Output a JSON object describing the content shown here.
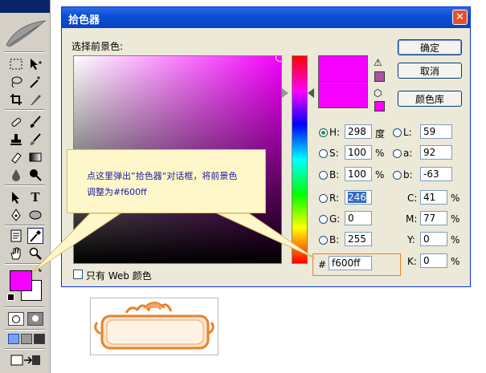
{
  "dialog": {
    "title": "拾色器",
    "close_glyph": "✕",
    "select_label": "选择前景色:",
    "ok_label": "确定",
    "cancel_label": "取消",
    "library_label": "颜色库",
    "web_only_label": "只有 Web 颜色",
    "warning_glyph": "⚠",
    "cube_glyph": "⬡"
  },
  "hsb": {
    "h_label": "H:",
    "h_value": "298",
    "h_unit": "度",
    "s_label": "S:",
    "s_value": "100",
    "s_unit": "%",
    "b_label": "B:",
    "b_value": "100",
    "b_unit": "%"
  },
  "rgb": {
    "r_label": "R:",
    "r_value": "246",
    "g_label": "G:",
    "g_value": "0",
    "b_label": "B:",
    "b_value": "255"
  },
  "lab": {
    "l_label": "L:",
    "l_value": "59",
    "a_label": "a:",
    "a_value": "92",
    "b_label": "b:",
    "b_value": "-63"
  },
  "cmyk": {
    "c_label": "C:",
    "c_value": "41",
    "c_unit": "%",
    "m_label": "M:",
    "m_value": "77",
    "m_unit": "%",
    "y_label": "Y:",
    "y_value": "0",
    "y_unit": "%",
    "k_label": "K:",
    "k_value": "0",
    "k_unit": "%"
  },
  "hex": {
    "label": "#",
    "value": "f600ff"
  },
  "callout": {
    "line1": "点这里弹出”拾色器“对话框，将前景色",
    "line2": "调整为#f600ff"
  },
  "colors": {
    "selected": "#f600ff",
    "previous": "#f600ff",
    "web_safe": "#ff00ff",
    "gamut_swatch": "#b050a8",
    "accent_orange": "#e8822a"
  },
  "toolbar": {
    "icons": [
      "marquee-icon",
      "move-icon",
      "lasso-icon",
      "magic-wand-icon",
      "crop-icon",
      "slice-icon",
      "healing-brush-icon",
      "brush-icon",
      "stamp-icon",
      "history-brush-icon",
      "eraser-icon",
      "gradient-icon",
      "blur-icon",
      "dodge-icon",
      "path-select-icon",
      "type-icon",
      "pen-icon",
      "shape-icon",
      "notes-icon",
      "eyedropper-icon",
      "hand-icon",
      "zoom-icon"
    ]
  }
}
